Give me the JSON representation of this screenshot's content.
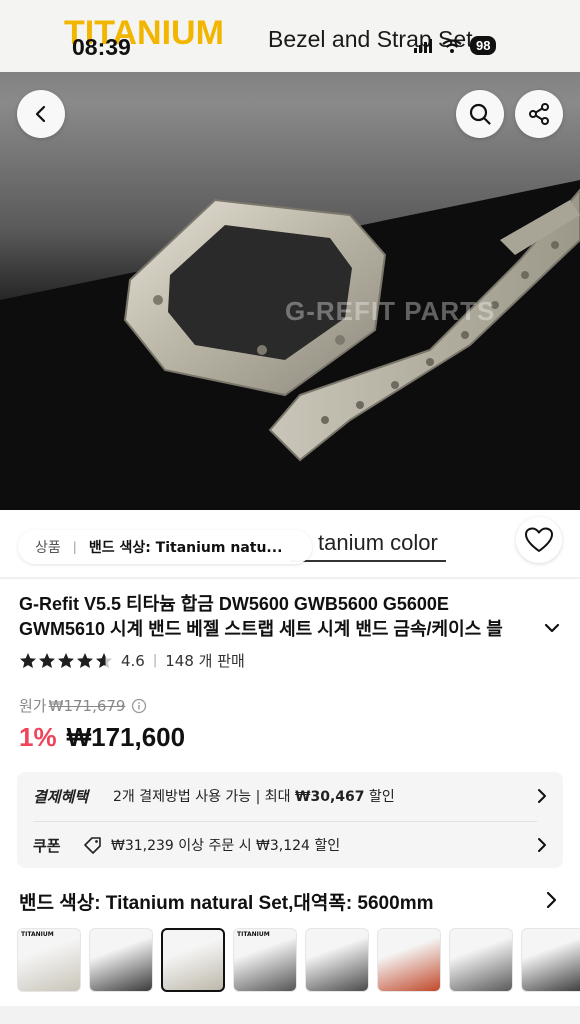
{
  "banner": {
    "brand": "TITANIUM",
    "subtitle": "Bezel and Strap Set"
  },
  "status_bar": {
    "time": "08:39",
    "battery": "98"
  },
  "top_buttons": {
    "back": "back-icon",
    "search": "search-icon",
    "share": "share-icon"
  },
  "watermark": "G-REFIT PARTS",
  "overlay_text": "tanium color",
  "breadcrumb": {
    "category": "상품",
    "separator": "|",
    "current": "밴드 색상: Titanium natu..."
  },
  "product": {
    "title_line1": "G-Refit V5.5 티타늄 합금 DW5600 GWB5600 G5600E",
    "title_line2": "GWM5610 시계 밴드 베젤 스트랩 세트 시계 밴드 금속/케이스 블",
    "rating": "4.6",
    "rating_stars": 4.6,
    "sold": "148 개 판매",
    "original_label": "원가",
    "original_price": "₩171,679",
    "discount": "1%",
    "price": "₩171,600"
  },
  "benefits": {
    "payment_label": "결제혜택",
    "payment_text_prefix": "2개 결제방법 사용 가능 | 최대 ",
    "payment_amount": "₩30,467",
    "payment_suffix": " 할인",
    "coupon_label": "쿠폰",
    "coupon_text": "₩31,239 이상 주문 시 ₩3,124 할인"
  },
  "variant": {
    "title": "밴드 색상: Titanium natural Set,대역폭: 5600mm",
    "thumbs": [
      {
        "label": "TITANIUM",
        "color": "#c8c4b8",
        "selected": false
      },
      {
        "label": "",
        "color": "#3a3a3a",
        "selected": false
      },
      {
        "label": "",
        "color": "#bdb8aa",
        "selected": true
      },
      {
        "label": "TITANIUM",
        "color": "#555555",
        "selected": false
      },
      {
        "label": "",
        "color": "#4a4a4a",
        "selected": false
      },
      {
        "label": "",
        "color": "#c0482a",
        "selected": false
      },
      {
        "label": "",
        "color": "#5a5a5a",
        "selected": false
      },
      {
        "label": "",
        "color": "#3c3c3c",
        "selected": false
      }
    ]
  },
  "colors": {
    "accent_red": "#f0445b",
    "brand_yellow": "#f2b600"
  }
}
